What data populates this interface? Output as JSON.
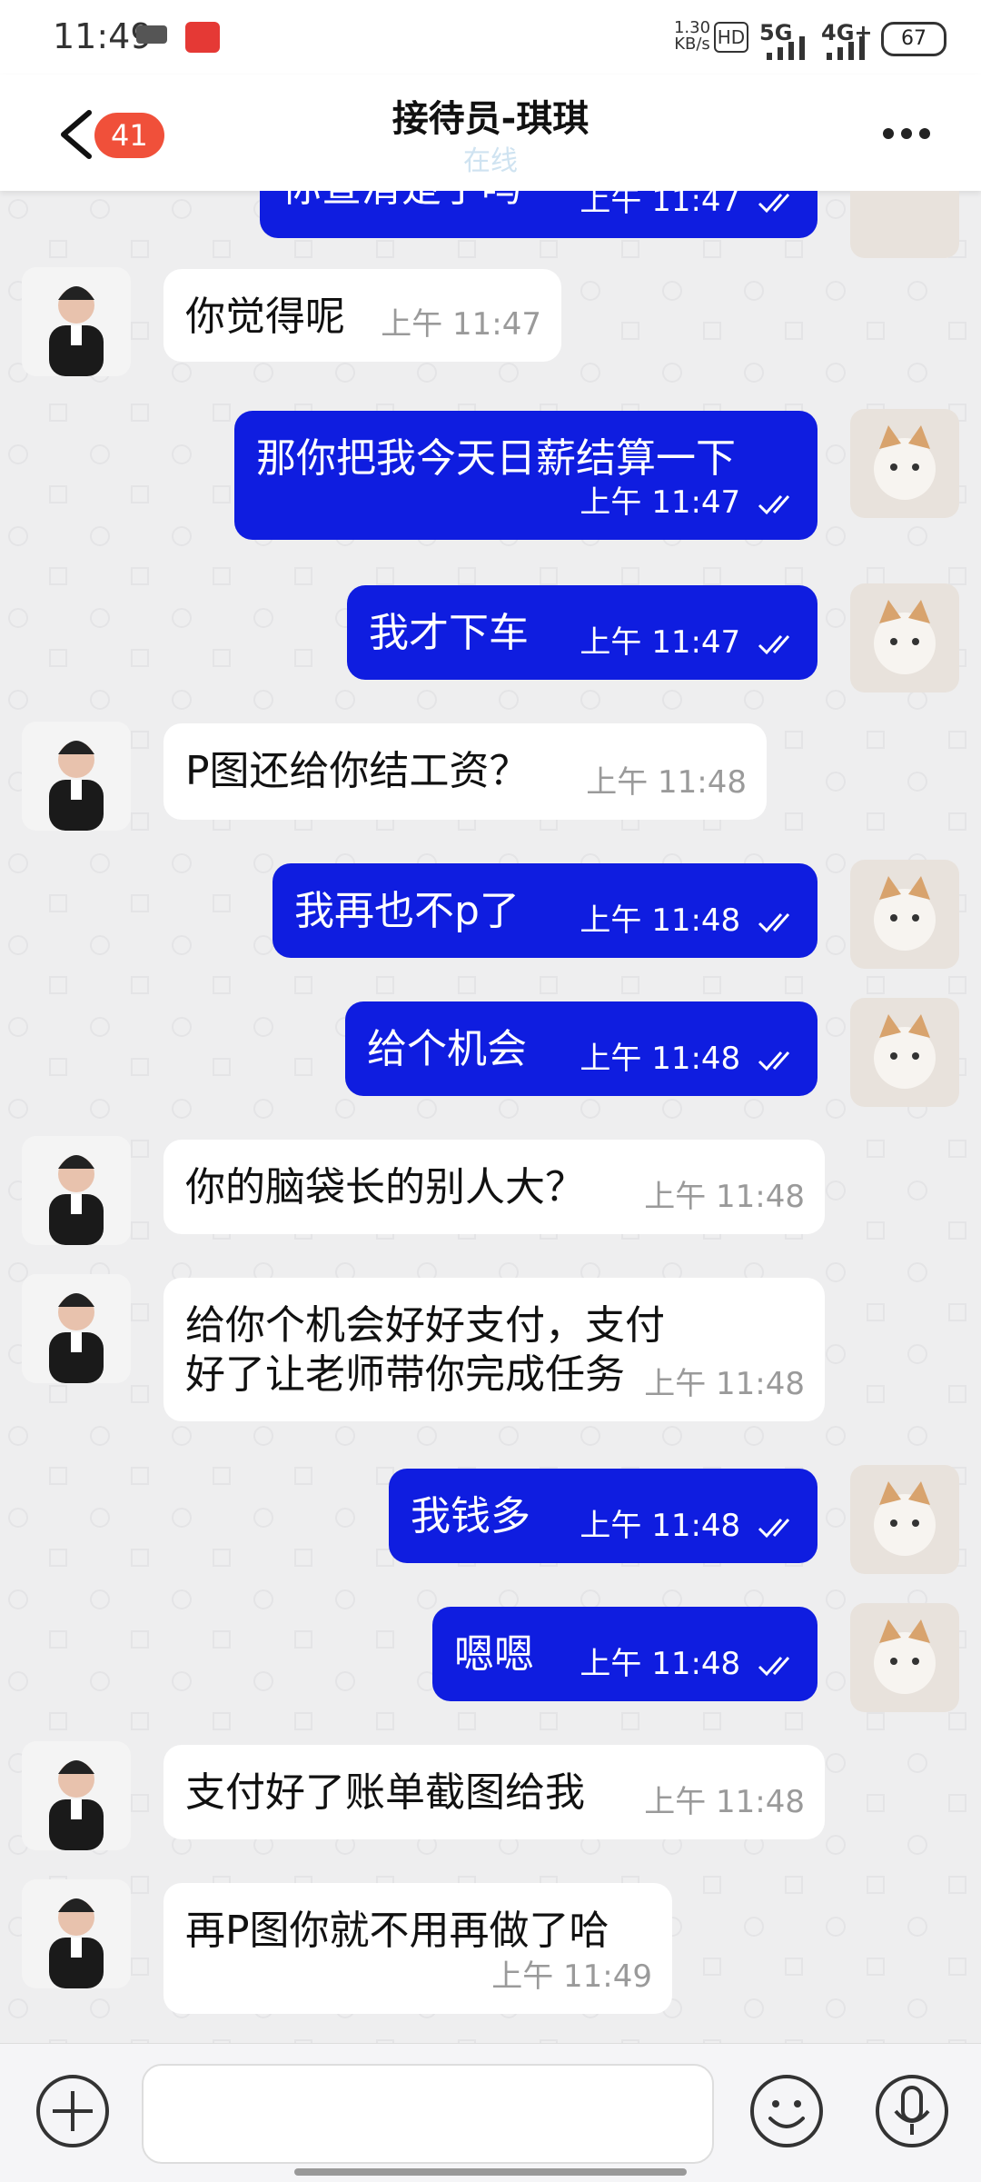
{
  "status_bar": {
    "time": "11:49",
    "net_speed": "1.30 KB/s",
    "hd": "HD",
    "network_1": "5G",
    "network_2": "4G+",
    "battery": "67"
  },
  "header": {
    "unread_count": "41",
    "title": "接待员-琪琪",
    "subtitle": "在线"
  },
  "messages": [
    {
      "side": "outgoing",
      "text": "你查清楚了吗",
      "time": "上午 11:47"
    },
    {
      "side": "incoming",
      "text": "你觉得呢",
      "time": "上午 11:47"
    },
    {
      "side": "outgoing",
      "text": "那你把我今天日薪结算一下",
      "time": "上午 11:47"
    },
    {
      "side": "outgoing",
      "text": "我才下车",
      "time": "上午 11:47"
    },
    {
      "side": "incoming",
      "text": "P图还给你结工资？",
      "time": "上午 11:48"
    },
    {
      "side": "outgoing",
      "text": "我再也不p了",
      "time": "上午 11:48"
    },
    {
      "side": "outgoing",
      "text": "给个机会",
      "time": "上午 11:48"
    },
    {
      "side": "incoming",
      "text": "你的脑袋长的别人大？",
      "time": "上午 11:48"
    },
    {
      "side": "incoming",
      "text": "给你个机会好好支付，支付好了让老师带你完成任务",
      "time": "上午 11:48"
    },
    {
      "side": "outgoing",
      "text": "我钱多",
      "time": "上午 11:48"
    },
    {
      "side": "outgoing",
      "text": "嗯嗯",
      "time": "上午 11:48"
    },
    {
      "side": "incoming",
      "text": "支付好了账单截图给我",
      "time": "上午 11:48"
    },
    {
      "side": "incoming",
      "text": "再P图你就不用再做了哈",
      "time": "上午 11:49"
    }
  ],
  "input": {
    "placeholder": ""
  },
  "icons": {
    "back": "chevron-left-icon",
    "more": "more-dots-icon",
    "plus": "plus-circle-icon",
    "emoji": "emoji-icon",
    "mic": "microphone-icon",
    "ticks": "double-check-icon"
  },
  "colors": {
    "outgoing_bubble": "#0f1de0",
    "incoming_bubble": "#ffffff",
    "badge": "#f0503a",
    "subtitle": "#cfe3f1"
  }
}
